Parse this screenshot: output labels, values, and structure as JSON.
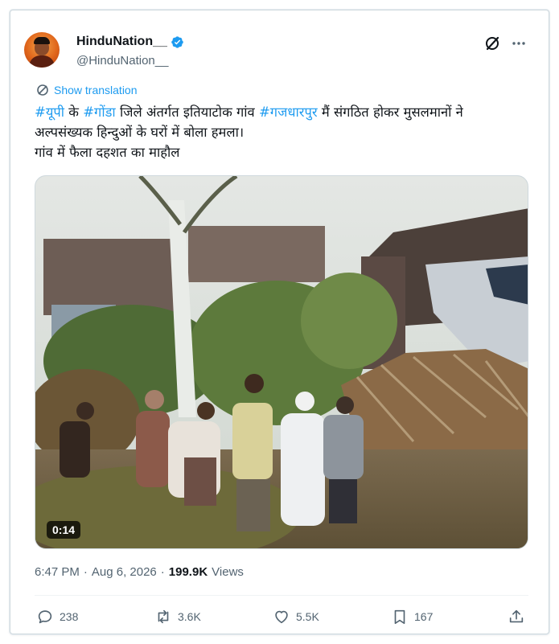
{
  "author": {
    "display_name": "HinduNation__",
    "handle": "@HinduNation__",
    "verified": true
  },
  "translate_label": "Show translation",
  "tweet": {
    "line1": [
      {
        "text": "#यूपी",
        "hashtag": true
      },
      {
        "text": " के ",
        "hashtag": false
      },
      {
        "text": "#गोंडा",
        "hashtag": true
      },
      {
        "text": " जिले अंतर्गत इतियाटोक गांव ",
        "hashtag": false
      },
      {
        "text": "#गजधारपुर",
        "hashtag": true
      },
      {
        "text": " मैं संगठित होकर मुसलमानों ने",
        "hashtag": false
      }
    ],
    "line2": "अल्पसंख्यक हिन्दुओं के घरों में बोला हमला।",
    "line3": "गांव में फैला दहशत का माहौल"
  },
  "media": {
    "type": "video",
    "duration": "0:14"
  },
  "meta": {
    "time": "6:47 PM",
    "separator": "·",
    "date": "Aug 6, 2026",
    "views_count": "199.9K",
    "views_label": "Views"
  },
  "actions": {
    "replies": "238",
    "reposts": "3.6K",
    "likes": "5.5K",
    "bookmarks": "167"
  },
  "icons": {
    "verified": "verified-badge-icon",
    "grok": "grok-icon",
    "more": "more-options-icon",
    "translate": "translate-icon",
    "reply": "reply-icon",
    "repost": "repost-icon",
    "like": "like-icon",
    "bookmark": "bookmark-icon",
    "share": "share-icon"
  },
  "colors": {
    "accent": "#1d9bf0",
    "text": "#0f1419",
    "secondary": "#536471",
    "border": "#cfd9de"
  }
}
